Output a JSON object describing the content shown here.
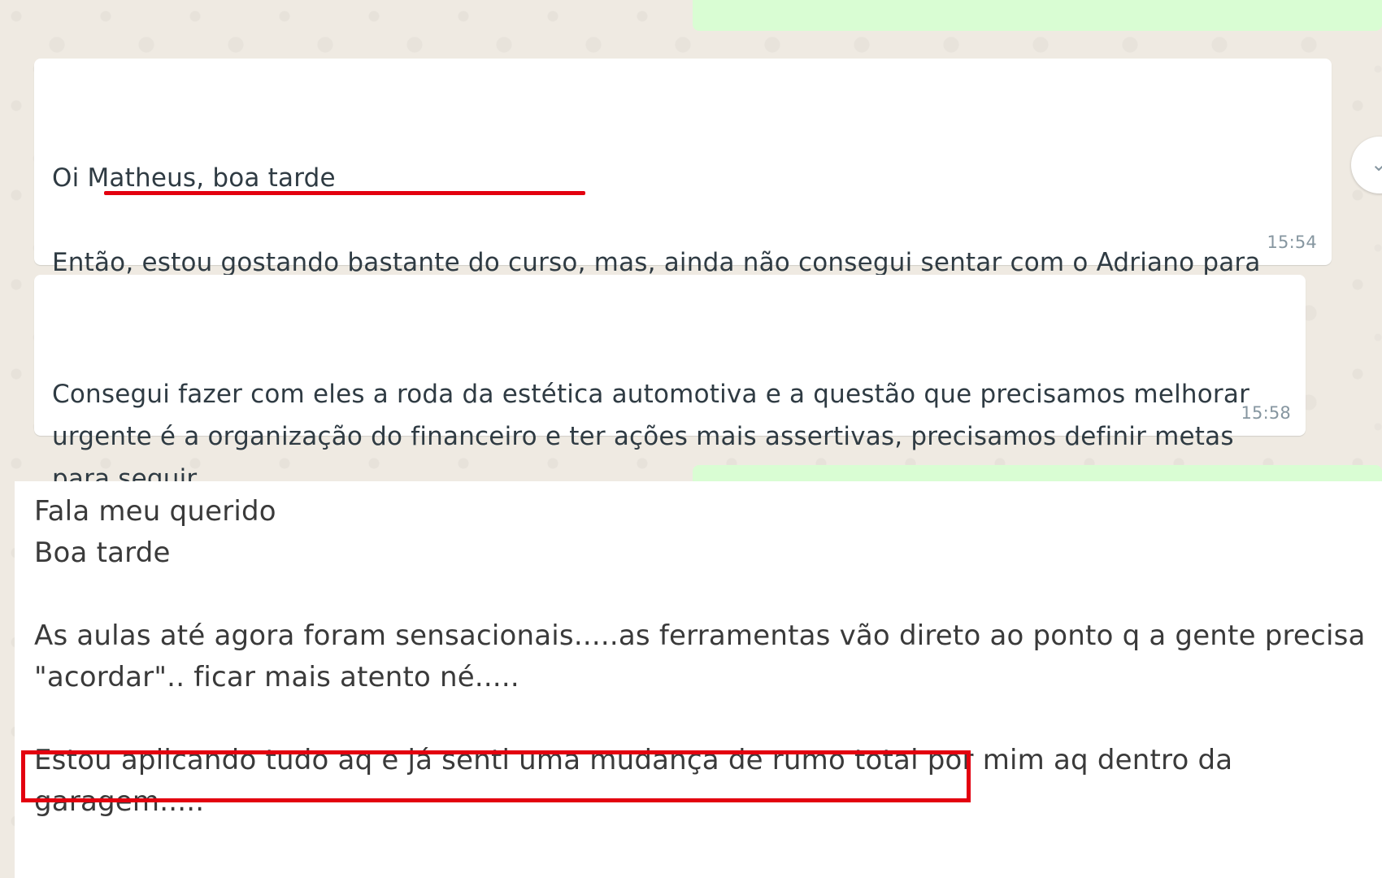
{
  "conversation": {
    "incoming_messages": [
      {
        "paragraph_1": "Oi Matheus, boa tarde",
        "paragraph_2_prefix": "Então, ",
        "paragraph_2_highlight": "estou gostando bastante do curso",
        "paragraph_2_suffix": ", mas, ainda não consegui sentar com o Adriano para colocar em prática as primeiras aulas.",
        "time": "15:54"
      },
      {
        "text": "Consegui fazer com eles a roda da estética automotiva e a questão que precisamos melhorar urgente é a organização do financeiro e ter ações mais assertivas, precisamos definir metas para seguir.",
        "time": "15:58"
      }
    ],
    "reply_excerpt": {
      "line_1": "Fala meu querido",
      "line_2": "Boa tarde",
      "paragraph_2": "As aulas até agora foram sensacionais.....as ferramentas vão direto ao ponto q a gente precisa \"acordar\".. ficar mais atento né.....",
      "highlighted_sentence": "Estou aplicando tudo aq e já senti uma mudança de rumo total",
      "paragraph_3_suffix": " por mim aq dentro da garagem....."
    },
    "scroll_icon": "chevron-down-icon",
    "colors": {
      "chat_background": "#efeae2",
      "incoming_bubble": "#ffffff",
      "outgoing_bubble": "#d9fdd3",
      "annotation_red": "#e3000f"
    }
  }
}
